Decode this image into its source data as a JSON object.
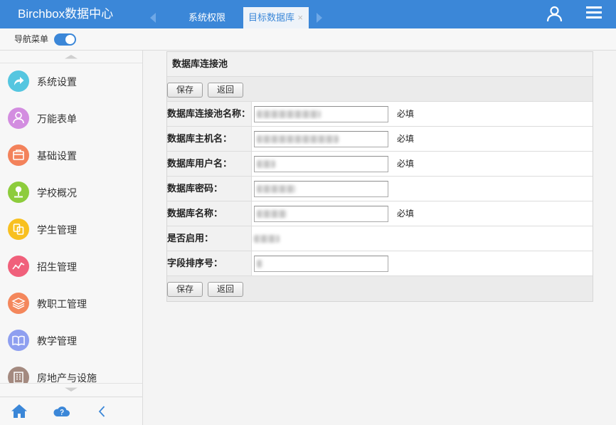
{
  "theme": {
    "primary": "#3b87d8"
  },
  "header": {
    "app_title": "Birchbox数据中心",
    "tabs": [
      {
        "label": "系统权限",
        "active": false
      },
      {
        "label": "目标数据库",
        "active": true,
        "close_label": "×"
      }
    ],
    "icons": {
      "scroll_left": "tab-scroll-left-icon",
      "scroll_right": "tab-scroll-right-icon",
      "user": "user-icon",
      "menu": "menu-icon"
    }
  },
  "nav_toggle": {
    "label": "导航菜单",
    "on": true
  },
  "sidebar": {
    "items": [
      {
        "label": "系统设置",
        "icon": "share-arrow-icon",
        "color": "#55c6e0"
      },
      {
        "label": "万能表单",
        "icon": "user-icon",
        "color": "#d38de0"
      },
      {
        "label": "基础设置",
        "icon": "box-icon",
        "color": "#f3825b"
      },
      {
        "label": "学校概况",
        "icon": "location-pin-icon",
        "color": "#8dcc3c"
      },
      {
        "label": "学生管理",
        "icon": "student-icon",
        "color": "#f8c020"
      },
      {
        "label": "招生管理",
        "icon": "trend-line-icon",
        "color": "#f0607b"
      },
      {
        "label": "教职工管理",
        "icon": "layers-icon",
        "color": "#f4875c"
      },
      {
        "label": "教学管理",
        "icon": "book-icon",
        "color": "#8e9ff0"
      },
      {
        "label": "房地产与设施",
        "icon": "building-icon",
        "color": "#a48a80"
      }
    ],
    "footer_icons": [
      "home-icon",
      "cloud-help-icon",
      "chevron-left-icon"
    ]
  },
  "form": {
    "title": "数据库连接池",
    "buttons": {
      "save": "保存",
      "back": "返回"
    },
    "fields": [
      {
        "label": "数据库连接池名称：",
        "value": "",
        "note": "必填"
      },
      {
        "label": "数据库主机名：",
        "value": "",
        "note": "必填"
      },
      {
        "label": "数据库用户名：",
        "value": "",
        "note": "必填"
      },
      {
        "label": "数据库密码：",
        "value": "",
        "note": ""
      },
      {
        "label": "数据库名称：",
        "value": "",
        "note": "必填"
      },
      {
        "label": "是否启用：",
        "value": "",
        "note": ""
      },
      {
        "label": "字段排序号：",
        "value": "",
        "note": ""
      }
    ]
  }
}
